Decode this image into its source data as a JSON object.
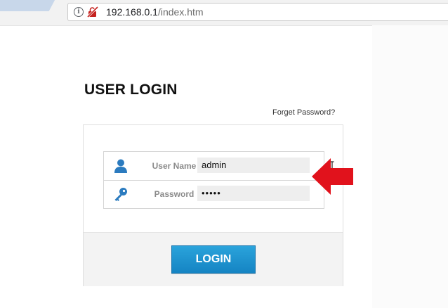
{
  "browser": {
    "url_host": "192.168.0.1",
    "url_path": "/index.htm",
    "icons": {
      "info": "info-icon",
      "not_secure": "not-secure-icon"
    }
  },
  "login": {
    "title": "USER LOGIN",
    "forget_password": "Forget Password?",
    "username_label": "User Name",
    "username_value": "admin",
    "password_label": "Password",
    "password_value": "•••••",
    "login_button": "LOGIN"
  },
  "colors": {
    "accent_blue": "#1b8fcf",
    "arrow_red": "#e1121c",
    "icon_blue": "#2b7bbf"
  }
}
